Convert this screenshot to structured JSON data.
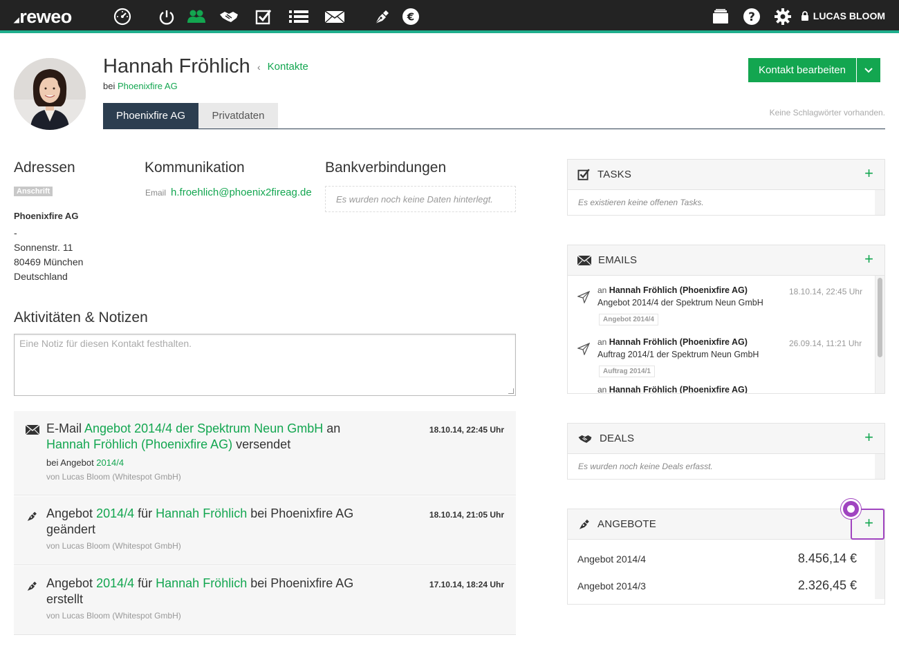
{
  "topbar": {
    "logo": "reweo",
    "user_name": "LUCAS BLOOM",
    "nav_icons": [
      "dashboard-icon",
      "power-icon",
      "contacts-icon",
      "deals-icon",
      "tasks-icon",
      "list-icon",
      "mail-icon",
      "offers-icon",
      "finance-icon"
    ],
    "right_icons": [
      "archive-icon",
      "help-icon",
      "settings-icon",
      "lock-icon"
    ],
    "accent_color": "#1fae8d",
    "active_icon_color": "#13a650"
  },
  "contact": {
    "name": "Hannah Fröhlich",
    "breadcrumb": "Kontakte",
    "company_prefix": "bei",
    "company": "Phoenixfire AG",
    "edit_button": "Kontakt bearbeiten",
    "no_tags": "Keine Schlagwörter vorhanden.",
    "tabs": [
      {
        "label": "Phoenixfire AG",
        "active": true
      },
      {
        "label": "Privatdaten",
        "active": false
      }
    ]
  },
  "addresses": {
    "heading": "Adressen",
    "badge": "Anschrift",
    "company": "Phoenixfire AG",
    "lines": [
      "-",
      "Sonnenstr. 11",
      "80469 München",
      "Deutschland"
    ]
  },
  "communication": {
    "heading": "Kommunikation",
    "label": "Email",
    "value": "h.froehlich@phoenix2fireag.de"
  },
  "bank": {
    "heading": "Bankverbindungen",
    "empty": "Es wurden noch keine Daten hinterlegt."
  },
  "activities": {
    "heading": "Aktivitäten & Notizen",
    "note_placeholder": "Eine Notiz für diesen Kontakt festhalten.",
    "items": [
      {
        "icon": "mail-icon",
        "t1": "E-Mail ",
        "link1": "Angebot 2014/4 der Spektrum Neun GmbH",
        "t2": " an ",
        "link2": "Hannah Fröhlich (Phoenixfire AG)",
        "t3": " versendet",
        "sub_prefix": "bei Angebot ",
        "sub_link": "2014/4",
        "by": "von Lucas Bloom (Whitespot GmbH)",
        "time": "18.10.14, 22:45 Uhr"
      },
      {
        "icon": "offers-icon",
        "t1": "Angebot ",
        "link1": "2014/4",
        "t2": " für ",
        "link2": "Hannah Fröhlich",
        "t3": " bei Phoenixfire AG geändert",
        "by": "von Lucas Bloom (Whitespot GmbH)",
        "time": "18.10.14, 21:05 Uhr"
      },
      {
        "icon": "offers-icon",
        "t1": "Angebot ",
        "link1": "2014/4",
        "t2": " für ",
        "link2": "Hannah Fröhlich",
        "t3": " bei Phoenixfire AG erstellt",
        "by": "von Lucas Bloom (Whitespot GmbH)",
        "time": "17.10.14, 18:24 Uhr"
      }
    ]
  },
  "widgets": {
    "tasks": {
      "title": "TASKS",
      "empty": "Es existieren keine offenen Tasks."
    },
    "emails": {
      "title": "EMAILS",
      "items": [
        {
          "prefix": "an ",
          "recipient": "Hannah Fröhlich (Phoenixfire AG)",
          "subject": "Angebot 2014/4 der Spektrum Neun GmbH",
          "chip": "Angebot 2014/4",
          "date": "18.10.14, 22:45 Uhr"
        },
        {
          "prefix": "an ",
          "recipient": "Hannah Fröhlich (Phoenixfire AG)",
          "subject": "Auftrag 2014/1 der Spektrum Neun GmbH",
          "chip": "Auftrag 2014/1",
          "date": "26.09.14, 11:21 Uhr"
        }
      ]
    },
    "deals": {
      "title": "DEALS",
      "empty": "Es wurden noch keine Deals erfasst."
    },
    "offers": {
      "title": "ANGEBOTE",
      "items": [
        {
          "name": "Angebot 2014/4",
          "amount": "8.456,14 €"
        },
        {
          "name": "Angebot 2014/3",
          "amount": "2.326,45 €"
        }
      ]
    },
    "plus": "+"
  }
}
